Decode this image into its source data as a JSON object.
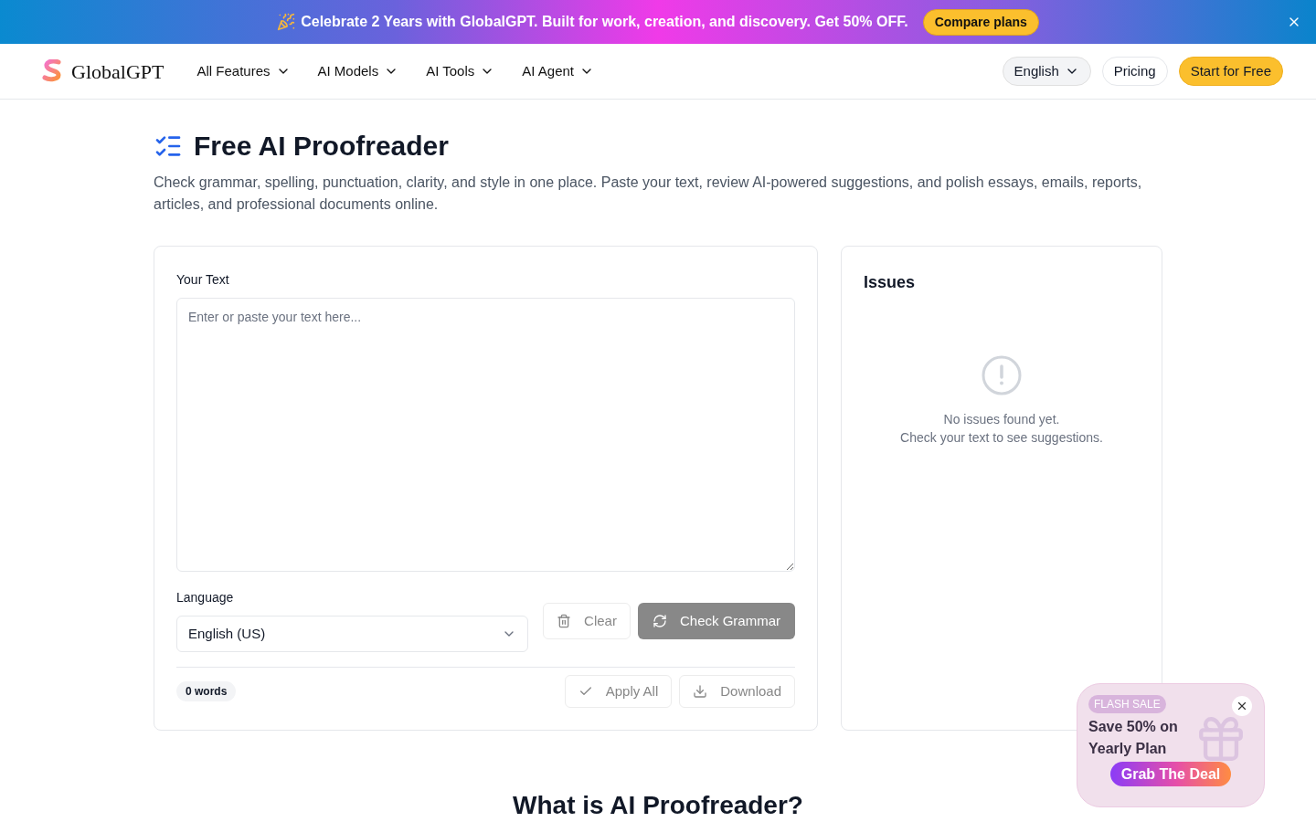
{
  "banner": {
    "text": "Celebrate 2 Years with GlobalGPT. Built for work, creation, and discovery. Get 50% OFF.",
    "button": "Compare plans"
  },
  "nav": {
    "brand": "GlobalGPT",
    "menus": [
      "All Features",
      "AI Models",
      "AI Tools",
      "AI Agent"
    ],
    "language": "English",
    "pricing": "Pricing",
    "cta": "Start for Free"
  },
  "hero": {
    "title": "Free AI Proofreader",
    "description": "Check grammar, spelling, punctuation, clarity, and style in one place. Paste your text, review AI-powered suggestions, and polish essays, emails, reports, articles, and professional documents online."
  },
  "editor": {
    "label": "Your Text",
    "placeholder": "Enter or paste your text here...",
    "language_label": "Language",
    "language": "English (US)",
    "actions": [
      {
        "kind": "clear",
        "label": "Clear",
        "disabled": true
      },
      {
        "kind": "check",
        "label": "Check Grammar",
        "disabled": true
      }
    ],
    "word_count": "0 words",
    "footer_actions": [
      {
        "kind": "apply",
        "label": "Apply All",
        "disabled": true
      },
      {
        "kind": "download",
        "label": "Download",
        "disabled": true
      }
    ]
  },
  "issues": {
    "title": "Issues",
    "empty_lines": [
      "No issues found yet.",
      "Check your text to see suggestions."
    ]
  },
  "section": {
    "heading": "What is AI Proofreader?"
  },
  "promo": {
    "badge": "FLASH SALE",
    "title": "Save 50% on Yearly Plan",
    "button": "Grab The Deal"
  }
}
